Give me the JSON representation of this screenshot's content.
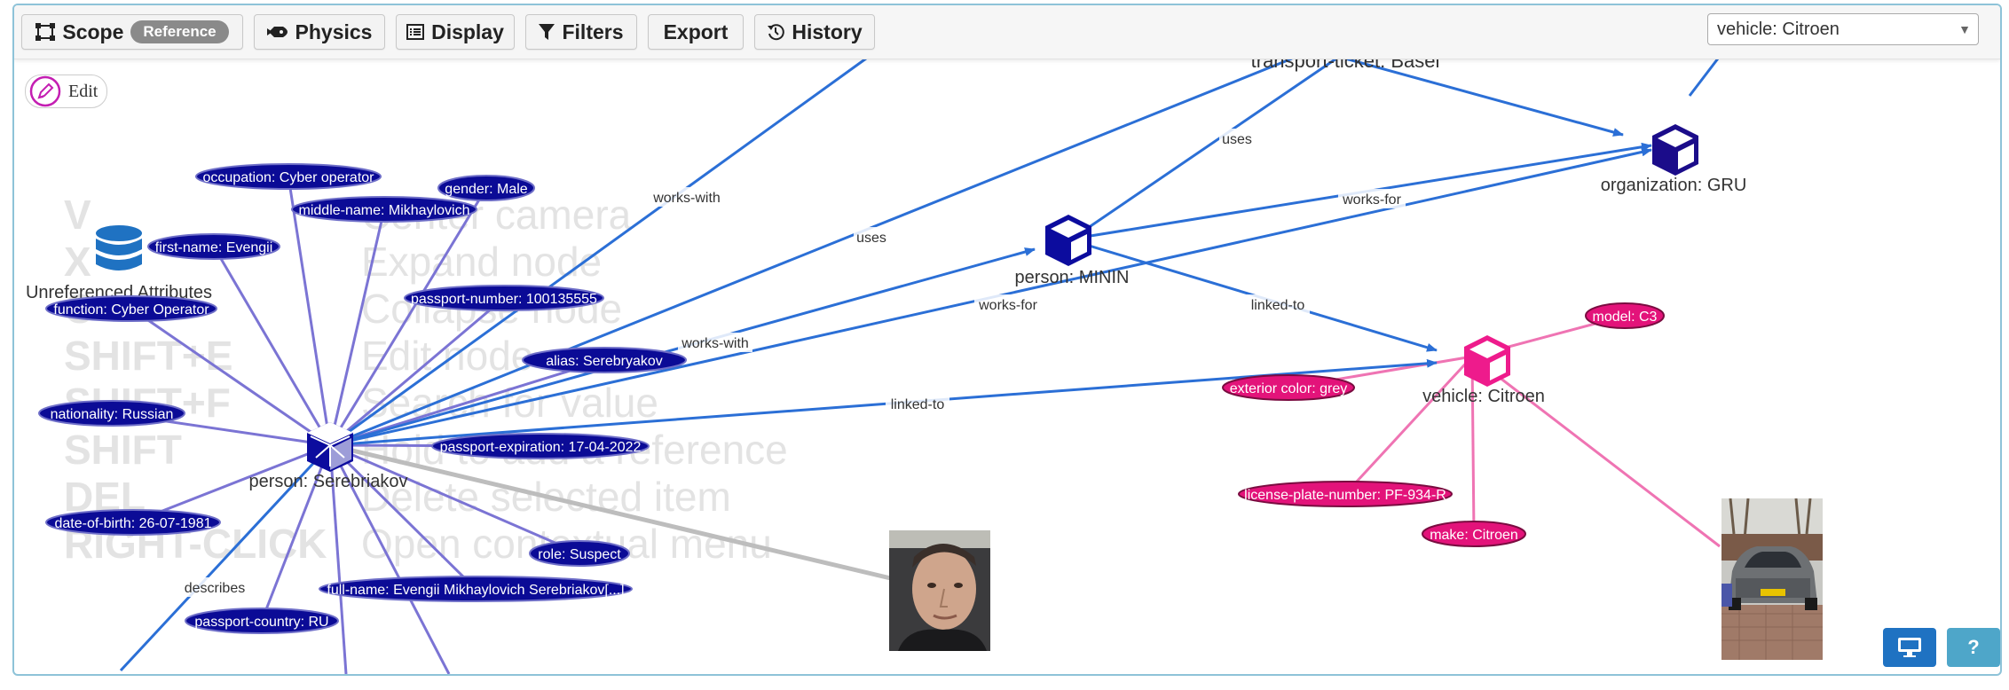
{
  "toolbar": {
    "scope_label": "Scope",
    "scope_badge": "Reference",
    "physics_label": "Physics",
    "display_label": "Display",
    "filters_label": "Filters",
    "export_label": "Export",
    "history_label": "History"
  },
  "selector": {
    "value": "vehicle: Citroen"
  },
  "edit": {
    "label": "Edit"
  },
  "hints": [
    {
      "key": "V",
      "action": "Center camera"
    },
    {
      "key": "X",
      "action": "Expand node"
    },
    {
      "key": "C",
      "action": "Collapse node"
    },
    {
      "key": "SHIFT+E",
      "action": "Edit node"
    },
    {
      "key": "SHIFT+F",
      "action": "Search for value"
    },
    {
      "key": "SHIFT",
      "action": "Hold to add a reference"
    },
    {
      "key": "DEL",
      "action": "Delete selected item"
    },
    {
      "key": "RIGHT-CLICK",
      "action": "Open contextual menu"
    }
  ],
  "graph": {
    "nodes": {
      "unreferenced": "Unreferenced Attributes",
      "serebriakov": "person: Serebriakov",
      "minin": "person: MININ",
      "gru": "organization: GRU",
      "citroen": "vehicle: Citroen",
      "ticket": "transport-ticket: Basel"
    },
    "attributes": {
      "occupation": "occupation: Cyber operator",
      "gender": "gender: Male",
      "middle_name": "middle-name: Mikhaylovich",
      "first_name": "first-name: Evengii",
      "function": "function: Cyber Operator",
      "passport_number": "passport-number: 100135555",
      "alias": "alias: Serebryakov",
      "nationality": "nationality: Russian",
      "passport_expiration": "passport-expiration: 17-04-2022",
      "date_of_birth": "date-of-birth: 26-07-1981",
      "role": "role: Suspect",
      "full_name": "full-name: Evengii Mikhaylovich Serebriakov[...]",
      "passport_country": "passport-country: RU",
      "model": "model: C3",
      "exterior_color": "exterior color: grey",
      "license_plate": "license-plate-number: PF-934-R",
      "make": "make: Citroen"
    },
    "edges": {
      "works_with_1": "works-with",
      "uses_1": "uses",
      "works_with_2": "works-with",
      "works_for_1": "works-for",
      "linked_to_1": "linked-to",
      "uses_2": "uses",
      "works_for_2": "works-for",
      "linked_to_2": "linked-to",
      "describes": "describes"
    }
  },
  "buttons": {
    "help_label": "?"
  },
  "colors": {
    "person_node": "#0c0c9e",
    "attribute_fill": "#0b0b96",
    "vehicle_node": "#ee1b8c",
    "vehicle_attribute": "#e3137a",
    "reference_edge": "#2b6fd6",
    "attribute_edge": "#7b74d4",
    "vehicle_edge": "#ef74b3",
    "image_edge": "#bdbdbd",
    "accent": "#1f72c2",
    "help_button": "#4ea6c9"
  }
}
